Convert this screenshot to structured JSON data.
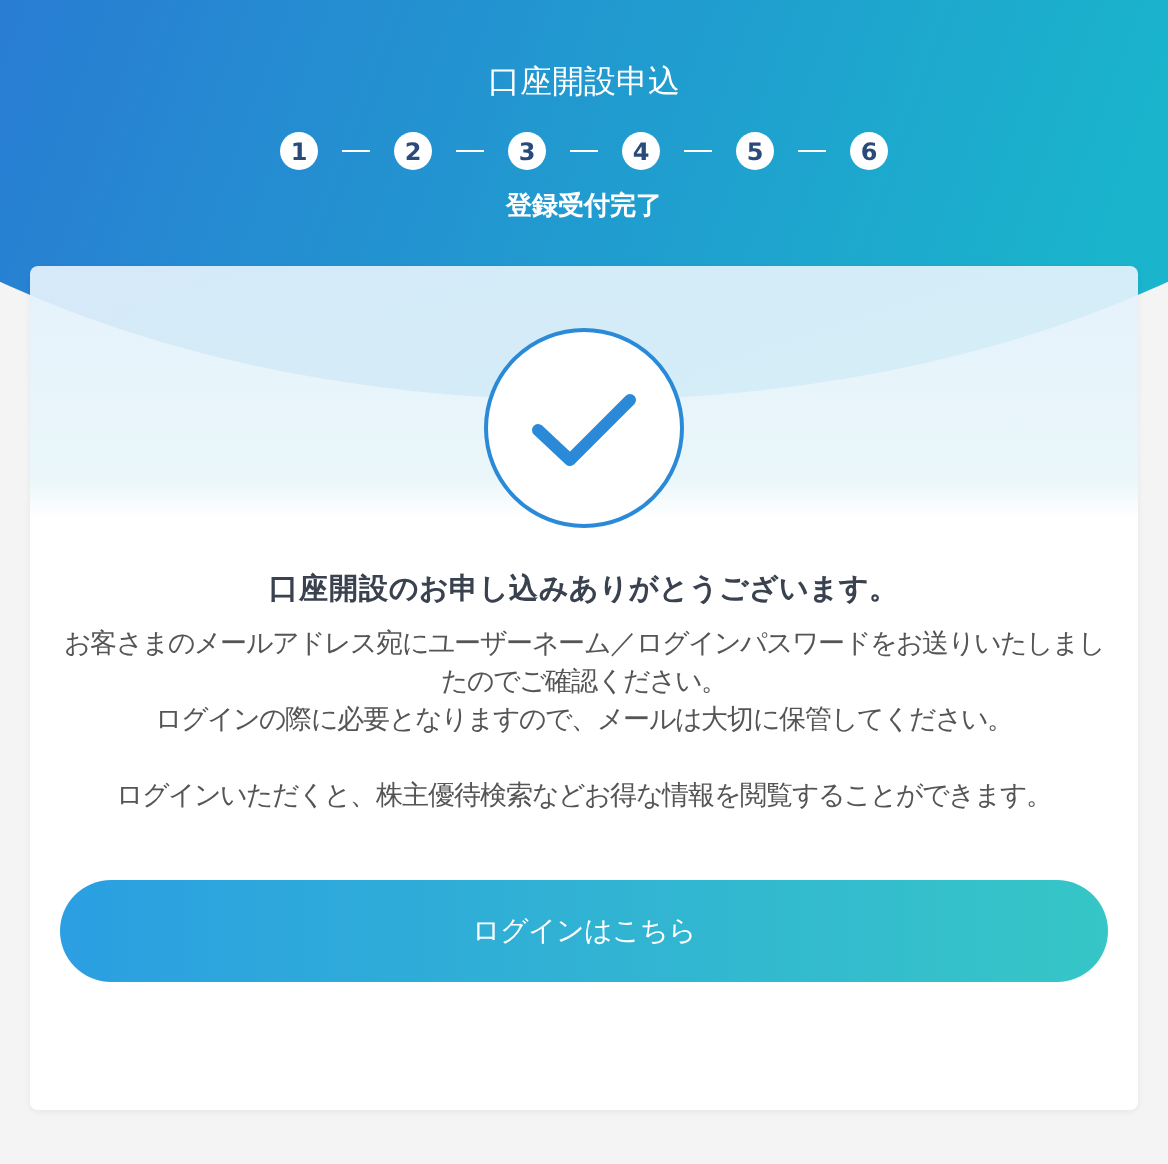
{
  "header": {
    "title": "口座開設申込",
    "steps": [
      "1",
      "2",
      "3",
      "4",
      "5",
      "6"
    ],
    "subtitle": "登録受付完了"
  },
  "card": {
    "heading": "口座開設のお申し込みありがとうございます。",
    "paragraphs": [
      "お客さまのメールアドレス宛にユーザーネーム／ログインパスワードをお送りいたしましたのでご確認ください。",
      "ログインの際に必要となりますので、メールは大切に保管してください。",
      "ログインいただくと、株主優待検索などお得な情報を閲覧することができます。"
    ],
    "button": "ログインはこちら"
  }
}
